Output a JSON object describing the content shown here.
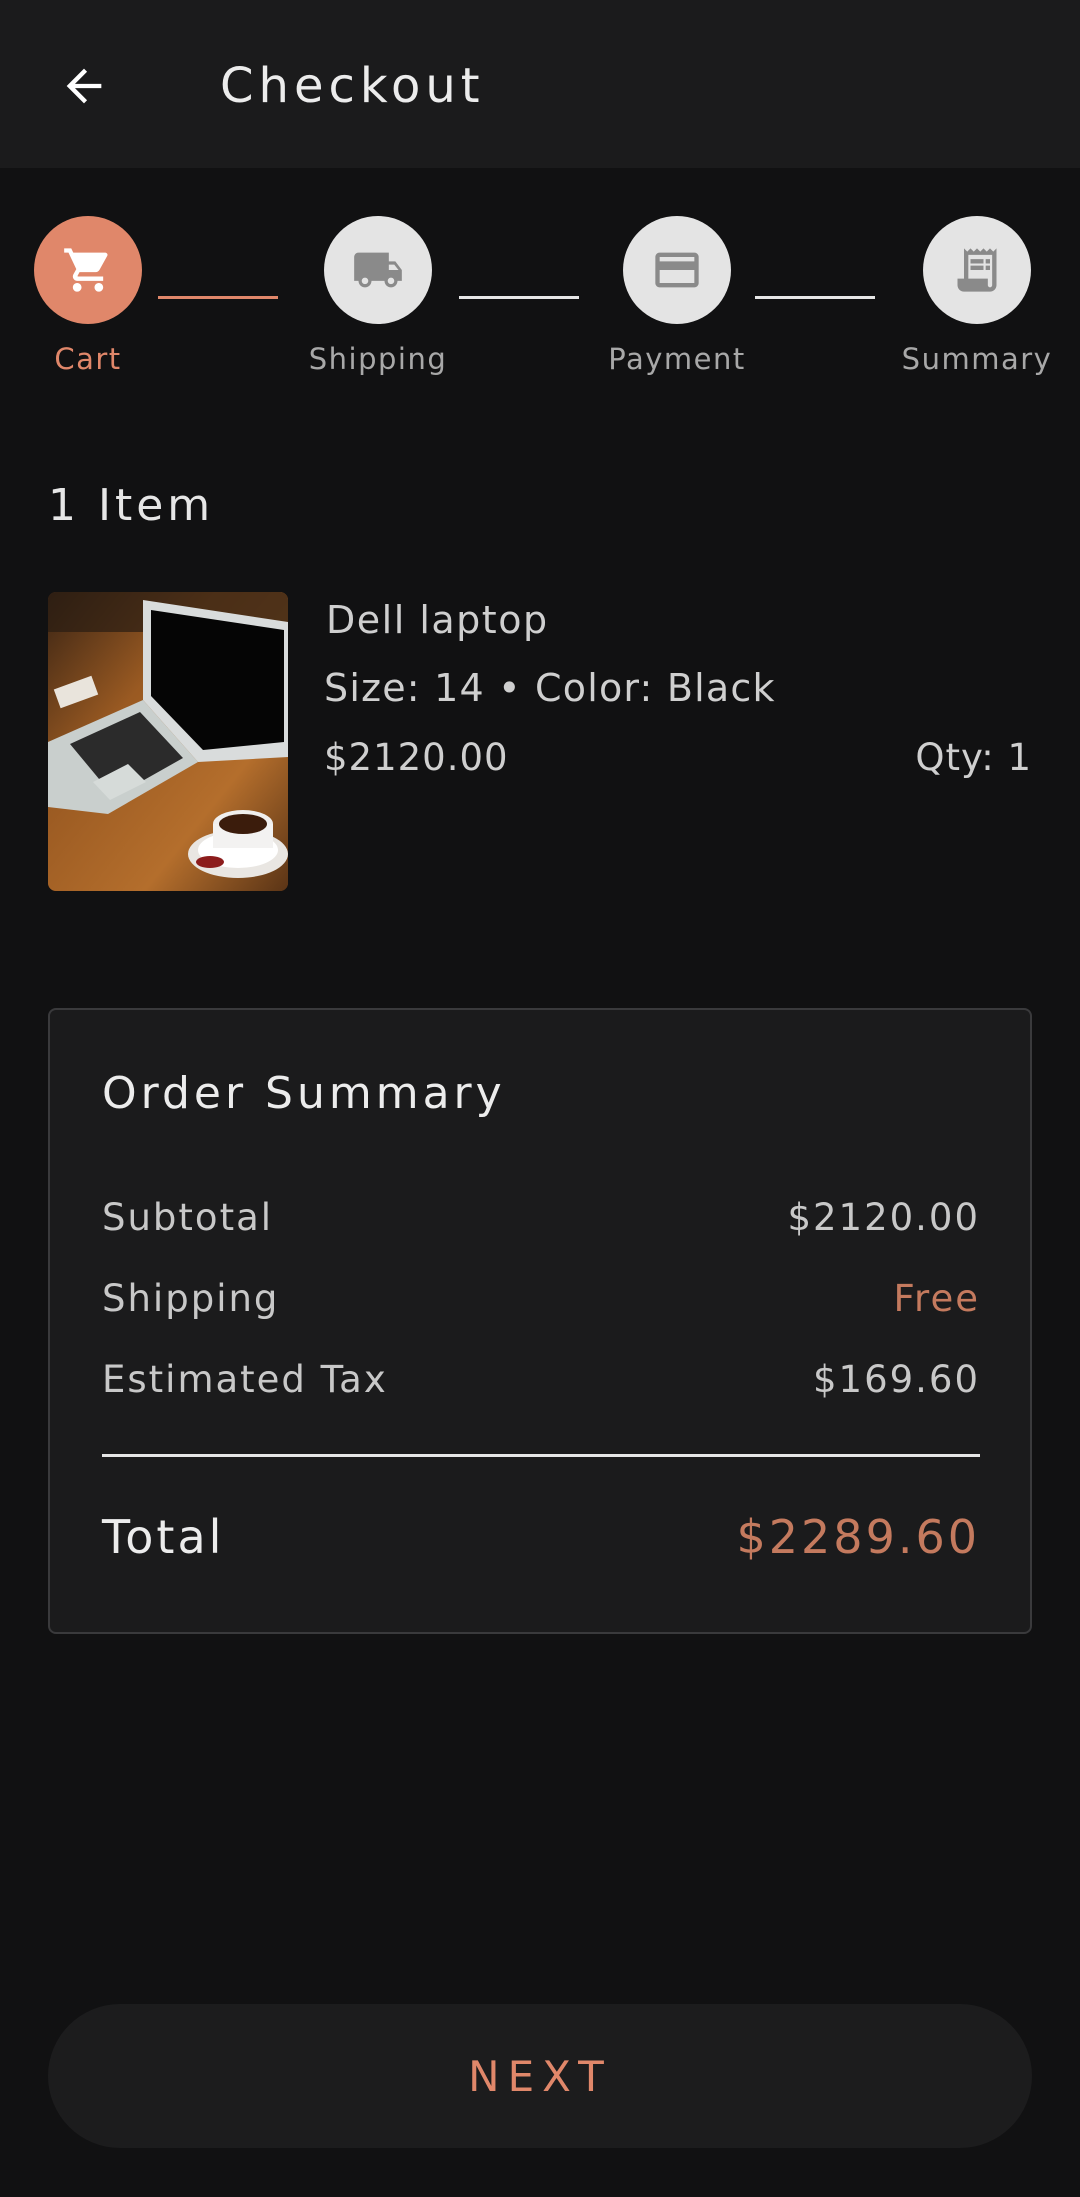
{
  "app_bar": {
    "title": "Checkout",
    "back_icon": "arrow-back-icon"
  },
  "stepper": {
    "steps": [
      {
        "label": "Cart",
        "icon": "cart-icon",
        "active": true
      },
      {
        "label": "Shipping",
        "icon": "truck-icon",
        "active": false
      },
      {
        "label": "Payment",
        "icon": "credit-card-icon",
        "active": false
      },
      {
        "label": "Summary",
        "icon": "receipt-icon",
        "active": false
      }
    ],
    "active_color": "#e0876a",
    "inactive_color": "#e4e4e4"
  },
  "cart": {
    "item_count_label": "1 Item",
    "items": [
      {
        "name": "Dell laptop",
        "attributes": "Size: 14 • Color: Black",
        "price": "$2120.00",
        "quantity": "Qty: 1",
        "image": "laptop-product-image"
      }
    ]
  },
  "order_summary": {
    "title": "Order Summary",
    "lines": [
      {
        "label": "Subtotal",
        "value": "$2120.00"
      },
      {
        "label": "Shipping",
        "value": "Free"
      },
      {
        "label": "Estimated Tax",
        "value": "$169.60"
      }
    ],
    "total_label": "Total",
    "total_value": "$2289.60",
    "accent_color": "#c47a5e"
  },
  "actions": {
    "next_label": "NEXT"
  }
}
